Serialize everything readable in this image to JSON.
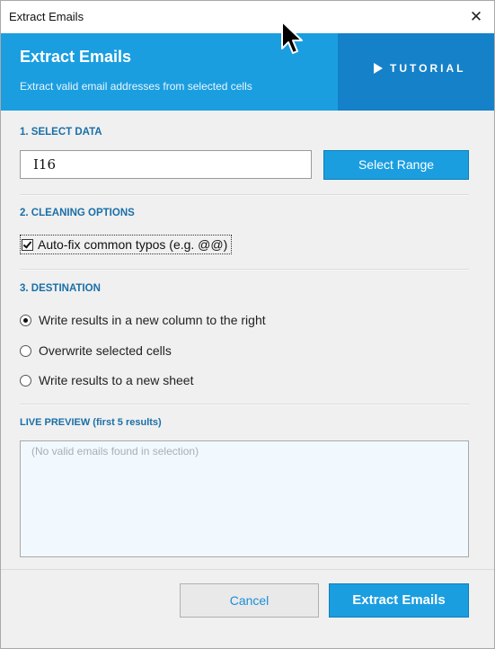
{
  "window": {
    "title": "Extract Emails",
    "close_glyph": "✕"
  },
  "banner": {
    "heading": "Extract Emails",
    "subheading": "Extract valid email addresses from selected cells",
    "tutorial_label": "TUTORIAL"
  },
  "select_data": {
    "label": "1. SELECT DATA",
    "range_value": "I16",
    "select_range_label": "Select Range"
  },
  "cleaning": {
    "label": "2. CLEANING OPTIONS",
    "autofix_label": "Auto-fix common typos (e.g. @@)",
    "autofix_checked": true
  },
  "destination": {
    "label": "3. DESTINATION",
    "options": [
      {
        "label": "Write results in a new column to the right",
        "selected": true
      },
      {
        "label": "Overwrite selected cells",
        "selected": false
      },
      {
        "label": "Write results to a new sheet",
        "selected": false
      }
    ]
  },
  "preview": {
    "label": "LIVE PREVIEW (first 5 results)",
    "placeholder": "(No valid emails found in selection)"
  },
  "footer": {
    "cancel_label": "Cancel",
    "extract_label": "Extract Emails"
  },
  "colors": {
    "accent": "#1a9ee0",
    "accent_dark": "#1581c8",
    "section_label": "#1a6fa8"
  }
}
